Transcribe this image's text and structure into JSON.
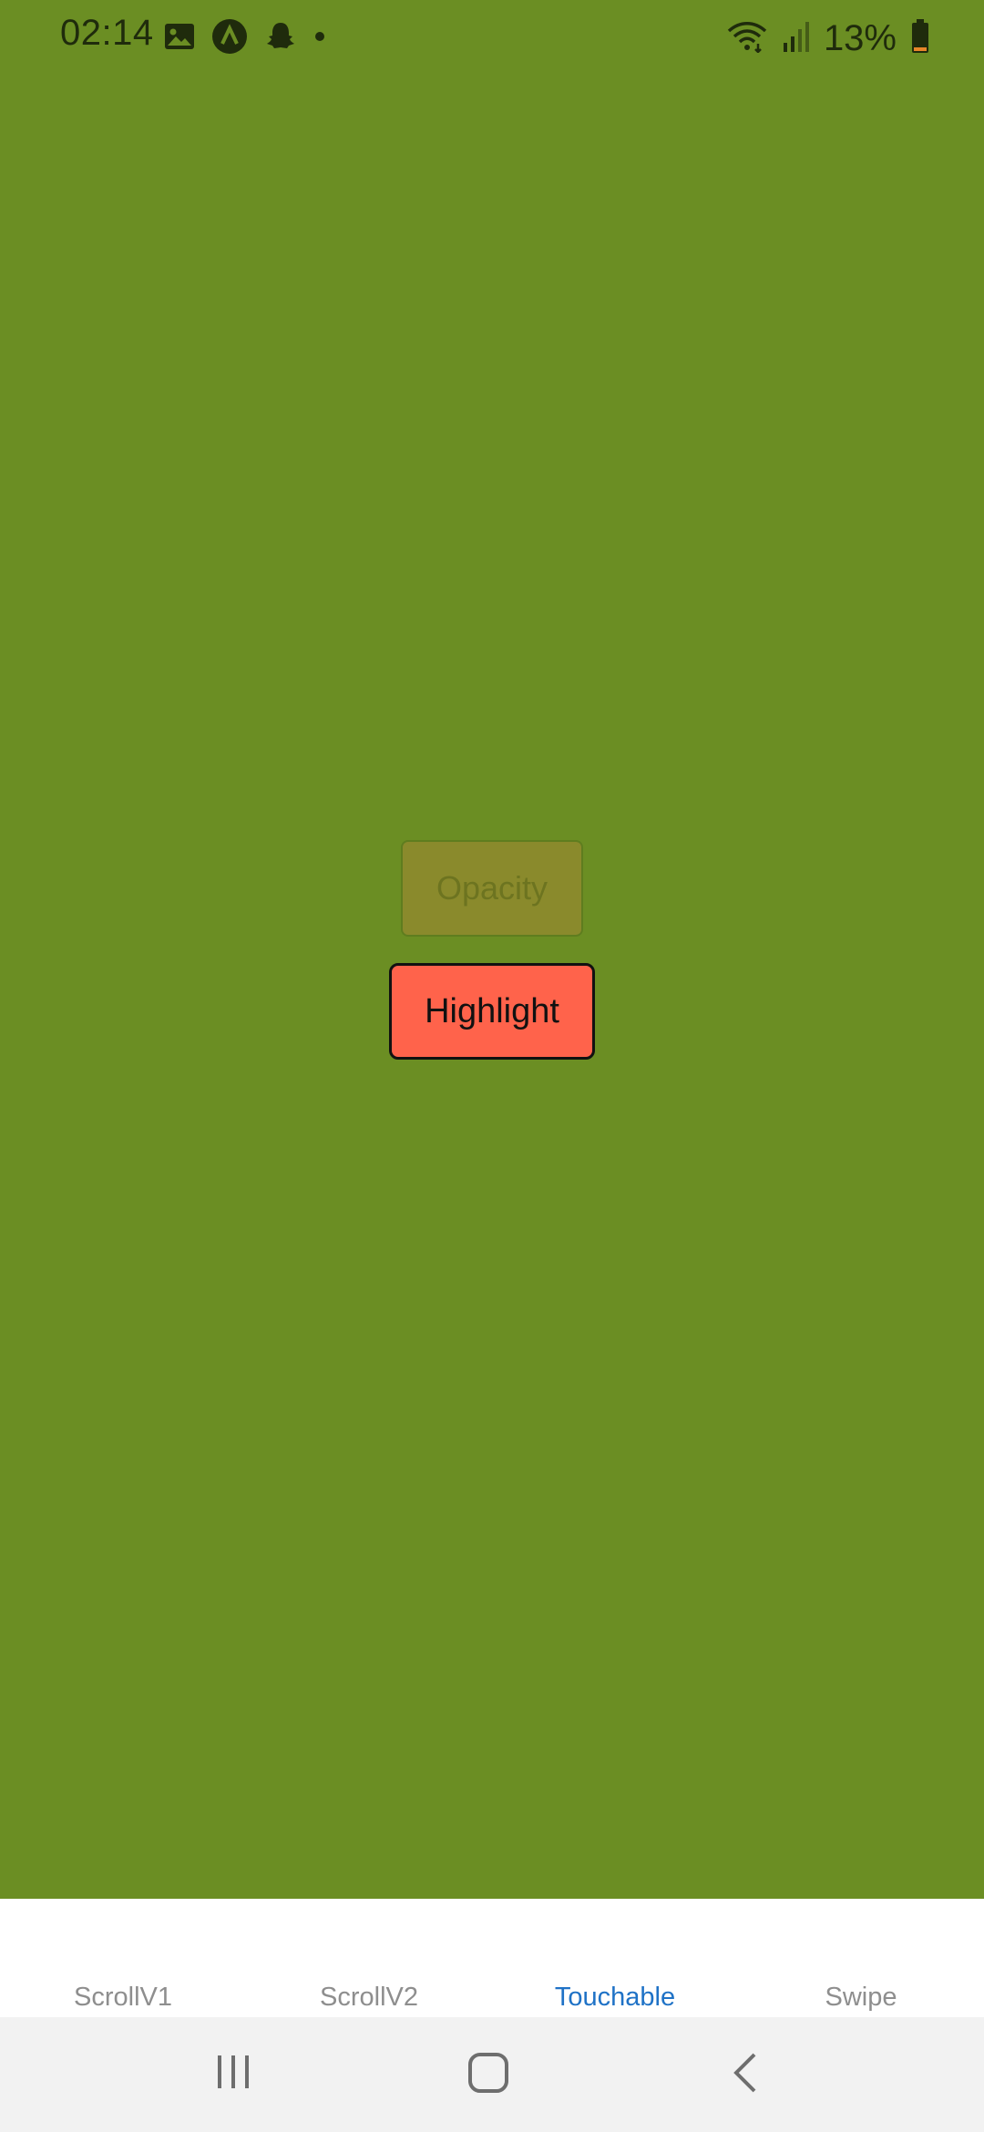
{
  "status_bar": {
    "time": "02:14",
    "battery": "13%",
    "icons_left": [
      "image-icon",
      "app-a-icon",
      "snapchat-icon",
      "dot-icon"
    ],
    "icons_right": [
      "wifi-icon",
      "signal-icon",
      "battery-icon"
    ],
    "battery_color": "#e8862a"
  },
  "main": {
    "background": "#6b8e23",
    "opacity_button_label": "Opacity",
    "highlight_button_label": "Highlight",
    "highlight_color": "#ff634b"
  },
  "tabs": [
    {
      "label": "ScrollV1",
      "active": false
    },
    {
      "label": "ScrollV2",
      "active": false
    },
    {
      "label": "Touchable",
      "active": true
    },
    {
      "label": "Swipe",
      "active": false
    }
  ],
  "nav_bar": {
    "icons": [
      "recents-icon",
      "home-icon",
      "back-icon"
    ]
  }
}
